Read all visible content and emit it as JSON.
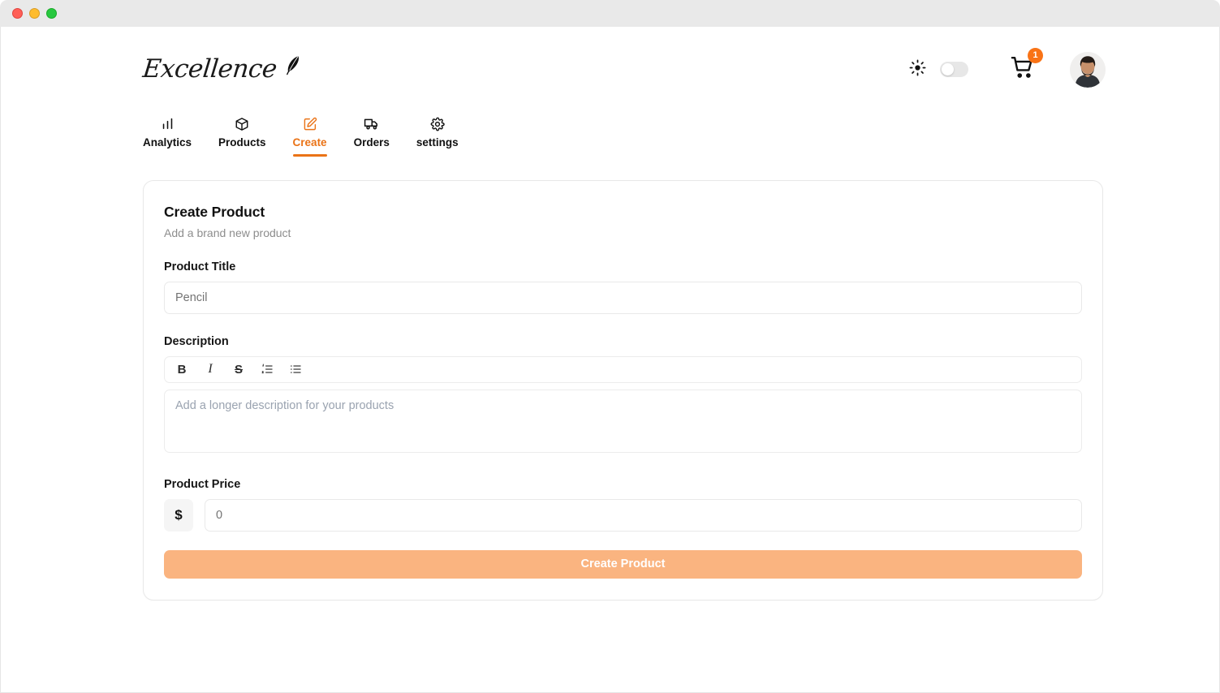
{
  "window": {
    "traffic_lights": [
      "close",
      "minimize",
      "maximize"
    ]
  },
  "header": {
    "logo_text": "Excellence",
    "logo_icon": "feather-icon",
    "theme_icon": "sun-icon",
    "theme_toggle_state": "off",
    "cart_icon": "shopping-cart-icon",
    "cart_badge_count": "1",
    "avatar_icon": "user-avatar"
  },
  "nav": {
    "tabs": [
      {
        "label": "Analytics",
        "icon": "bar-chart-icon",
        "active": false
      },
      {
        "label": "Products",
        "icon": "package-box-icon",
        "active": false
      },
      {
        "label": "Create",
        "icon": "square-pen-icon",
        "active": true
      },
      {
        "label": "Orders",
        "icon": "truck-icon",
        "active": false
      },
      {
        "label": "settings",
        "icon": "gear-icon",
        "active": false
      }
    ]
  },
  "form": {
    "title": "Create Product",
    "subtitle": "Add a brand new product",
    "product_title": {
      "label": "Product Title",
      "value": "",
      "placeholder": "Pencil"
    },
    "description": {
      "label": "Description",
      "value": "",
      "placeholder": "Add a longer description for your products",
      "toolbar": [
        {
          "label": "B",
          "name": "bold-button"
        },
        {
          "label": "I",
          "name": "italic-button"
        },
        {
          "label": "S",
          "name": "strikethrough-button"
        },
        {
          "label": "",
          "name": "ordered-list-button"
        },
        {
          "label": "",
          "name": "unordered-list-button"
        }
      ]
    },
    "price": {
      "label": "Product Price",
      "currency_symbol": "$",
      "value": "",
      "placeholder": "0"
    },
    "submit_label": "Create Product"
  },
  "colors": {
    "accent": "#ea7317",
    "badge": "#f97316",
    "submit_button": "#fab480",
    "titlebar": "#e9e9e9",
    "border": "#e8e8e8"
  }
}
